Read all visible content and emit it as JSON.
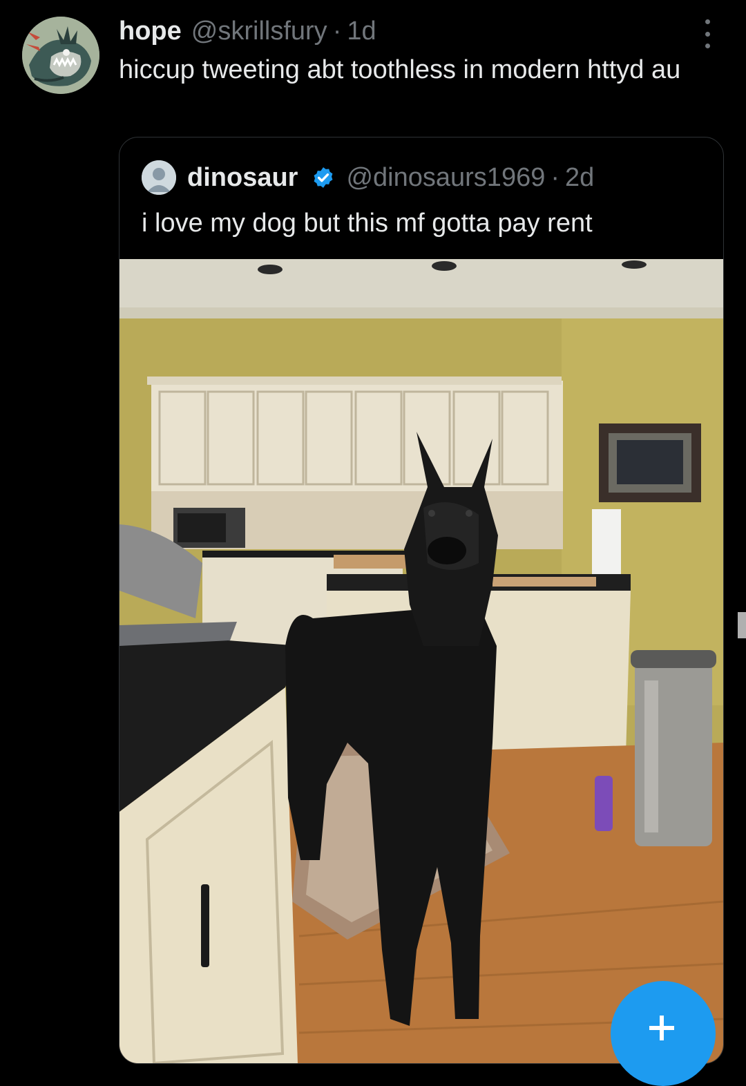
{
  "tweet": {
    "display_name": "hope",
    "handle": "@skrillsfury",
    "separator": "·",
    "time": "1d",
    "text": "hiccup tweeting abt toothless in modern httyd au",
    "avatar_icon": "dragon-avatar",
    "more_icon": "more-dots-icon"
  },
  "quoted_tweet": {
    "display_name": "dinosaur",
    "verified_icon": "verified-badge-icon",
    "handle": "@dinosaurs1969",
    "separator": "·",
    "time": "2d",
    "text": "i love my dog but this mf gotta pay rent",
    "photo": "great-dane-in-kitchen"
  },
  "compose_button": {
    "icon": "plus-icon",
    "color": "#1d9bf0"
  },
  "colors": {
    "background": "#000000",
    "text_primary": "#e7e9ea",
    "text_secondary": "#71767b",
    "verified": "#1d9bf0",
    "border": "#2f3336"
  }
}
